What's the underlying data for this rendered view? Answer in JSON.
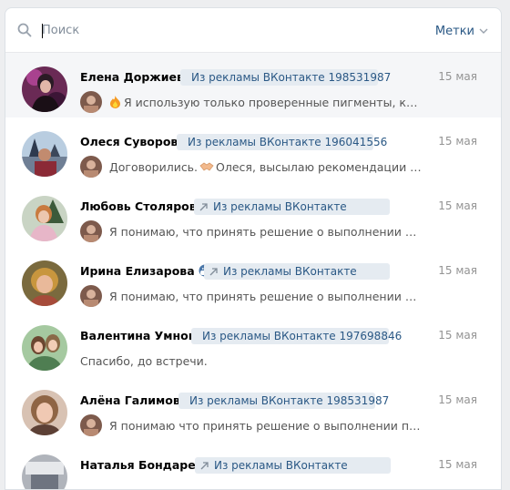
{
  "search": {
    "placeholder": "Поиск"
  },
  "labels_button": "Метки",
  "dialogs": [
    {
      "name": "Елена Доржиева",
      "ad_tag": "Из рекламы ВКонтакте 198531987",
      "date": "15 мая",
      "preview": "Я использую только проверенные пигменты, котор...",
      "preview_emoji": "fire-icon"
    },
    {
      "name": "Олеся Суворова",
      "ad_tag": "Из рекламы ВКонтакте 196041556",
      "date": "15 мая",
      "preview_before": "Договорились.",
      "preview": "Олеся, высылаю рекомендации пере...",
      "preview_emoji": "handshake-icon"
    },
    {
      "name": "Любовь Столярова",
      "ad_tag": "Из рекламы ВКонтакте",
      "date": "15 мая",
      "preview": "Я понимаю, что принять решение о выполнении проце..."
    },
    {
      "name": "Ирина Елизарова",
      "name_emoji": "mask-face-icon",
      "ad_tag": "Из рекламы ВКонтакте",
      "date": "15 мая",
      "preview": "Я понимаю, что принять решение о выполнении проце..."
    },
    {
      "name": "Валентина Умнова",
      "ad_tag": "Из рекламы ВКонтакте 197698846",
      "date": "15 мая",
      "preview": "Спасибо, до встречи."
    },
    {
      "name": "Алёна Галимова",
      "ad_tag": "Из рекламы ВКонтакте 198531987",
      "date": "15 мая",
      "preview": "Я понимаю что принять решение о выполнении процед..."
    },
    {
      "name": "Наталья Бондарева",
      "ad_tag": "Из рекламы ВКонтакте",
      "date": "15 мая"
    }
  ]
}
